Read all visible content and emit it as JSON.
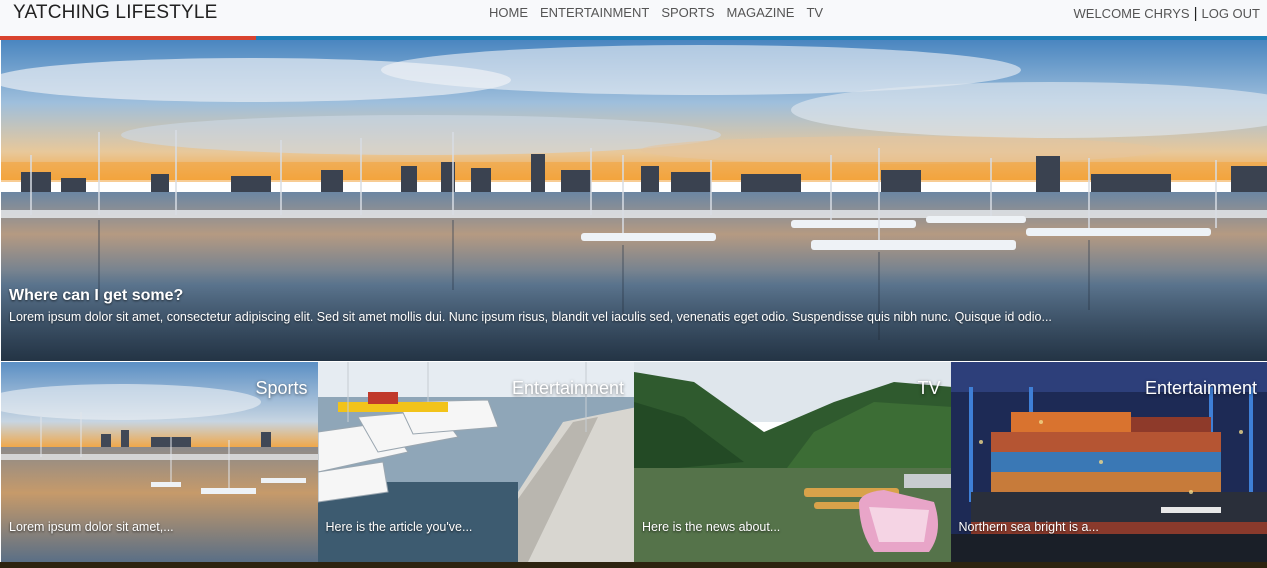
{
  "header": {
    "brand": "YATCHING LIFESTYLE",
    "nav": [
      "HOME",
      "ENTERTAINMENT",
      "SPORTS",
      "MAGAZINE",
      "TV"
    ],
    "welcome": "WELCOME CHRYS",
    "separator": "|",
    "logout": "LOG OUT"
  },
  "colors": {
    "accent_blue": "#1e7fb8",
    "accent_red": "#d9432f",
    "footer": "#2d2410"
  },
  "hero": {
    "title": "Where can I get some?",
    "text": "Lorem ipsum dolor sit amet, consectetur adipiscing elit. Sed sit amet mollis dui. Nunc ipsum risus, blandit vel iaculis sed, venenatis eget odio. Suspendisse quis nibh nunc. Quisque id odio..."
  },
  "cards": [
    {
      "tag": "Sports",
      "text": "Lorem ipsum dolor sit amet,..."
    },
    {
      "tag": "Entertainment",
      "text": "Here is the article you've..."
    },
    {
      "tag": "TV",
      "text": "Here is the news about..."
    },
    {
      "tag": "Entertainment",
      "text": "Northern sea bright is a..."
    }
  ]
}
